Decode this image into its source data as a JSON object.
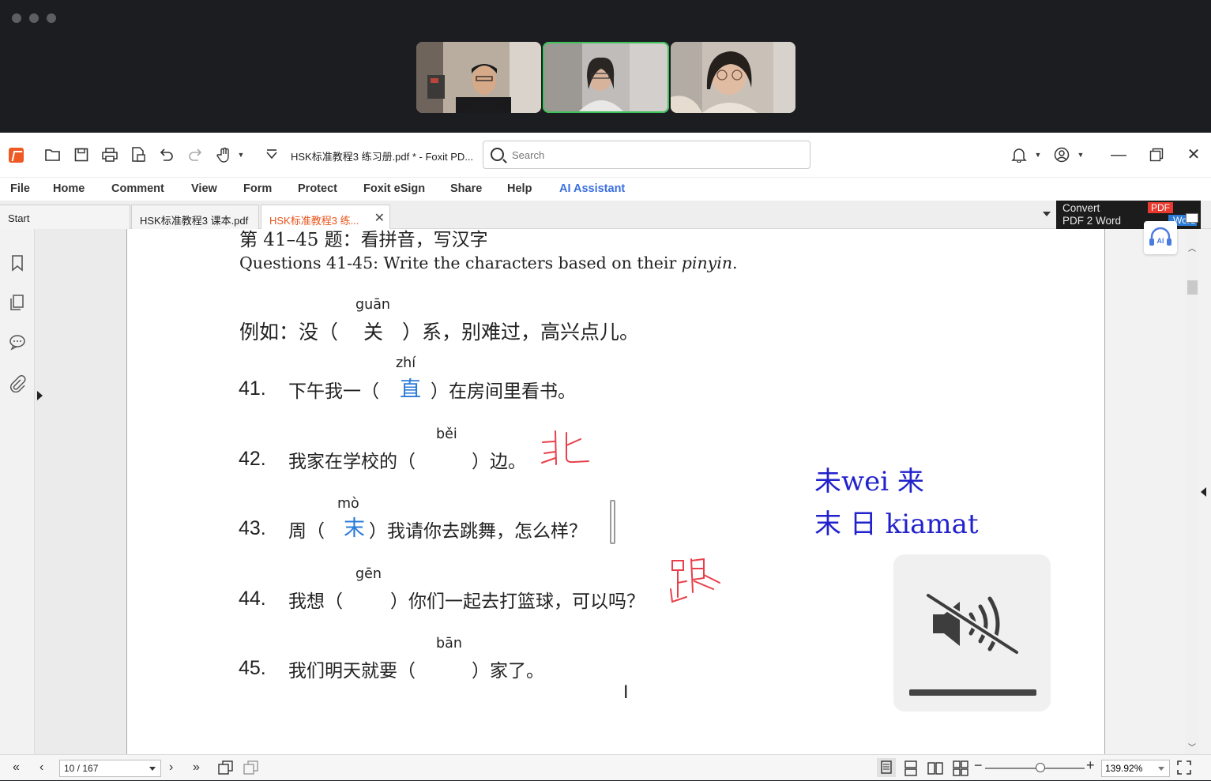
{
  "call": {
    "participants": [
      "participant-1",
      "participant-2",
      "participant-3"
    ],
    "active_index": 1,
    "active_color": "#3ec35a"
  },
  "app": {
    "title": "HSK标准教程3 练习册.pdf * - Foxit PD...",
    "search_placeholder": "Search",
    "menu": [
      "File",
      "Home",
      "Comment",
      "View",
      "Form",
      "Protect",
      "Foxit eSign",
      "Share",
      "Help",
      "AI Assistant"
    ],
    "tabs": {
      "start": "Start",
      "tab1": "HSK标准教程3 课本.pdf",
      "tab2": "HSK标准教程3 练..."
    },
    "convert_ad": {
      "line1": "Convert",
      "line2": "PDF 2 Word",
      "pdf_badge": "PDF",
      "word_badge": "Word"
    },
    "ai_badge": "AI",
    "accent_color": "#e8541b"
  },
  "doc": {
    "heading": "第 41–45 题：看拼音，写汉字",
    "subheading": "Questions 41-45: Write the characters based on their ",
    "subheading_em": "pinyin",
    "subheading_end": ".",
    "example": {
      "label": "例如：没（",
      "pinyin": "guān",
      "char": "关",
      "rest": "）系，别难过，高兴点儿。"
    },
    "questions": [
      {
        "num": "41.",
        "pinyin": "zhí",
        "before": "下午我一（",
        "answer": "直",
        "after": "）在房间里看书。"
      },
      {
        "num": "42.",
        "pinyin": "běi",
        "before": "我家在学校的（",
        "answer": "",
        "after": "）边。"
      },
      {
        "num": "43.",
        "pinyin": "mò",
        "before": "周（",
        "answer": "末",
        "after": "）我请你去跳舞，怎么样？"
      },
      {
        "num": "44.",
        "pinyin": "gēn",
        "before": "我想（",
        "answer": "",
        "after": "）你们一起去打篮球，可以吗？"
      },
      {
        "num": "45.",
        "pinyin": "bān",
        "before": "我们明天就要（",
        "answer": "",
        "after": "）家了。"
      }
    ],
    "note_line1": "未wei 来",
    "note_line2": "末 日  kiamat",
    "red_answer_color": "#e8404a",
    "blue_answer_color": "#2b7bd8"
  },
  "status": {
    "page_value": "10 / 167",
    "zoom_value": "139.92%",
    "zoom_level": 0.5
  }
}
